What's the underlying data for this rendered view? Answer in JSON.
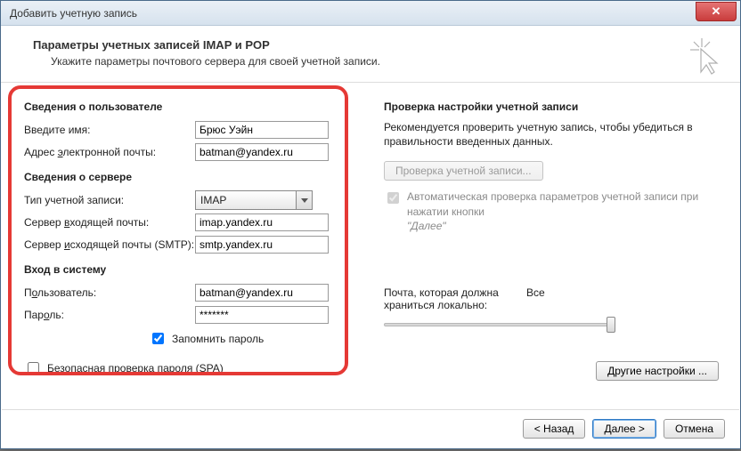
{
  "window": {
    "title": "Добавить учетную запись",
    "close_glyph": "✕"
  },
  "header": {
    "title": "Параметры учетных записей IMAP и POP",
    "sub": "Укажите параметры почтового сервера для своей учетной записи."
  },
  "sections": {
    "user": "Сведения о пользователе",
    "server": "Сведения о сервере",
    "login": "Вход в систему"
  },
  "labels": {
    "name": "Введите имя:",
    "email_pre": "Адрес ",
    "email_u": "э",
    "email_post": "лектронной почты:",
    "acct_type": "Тип учетной записи:",
    "in_server": "Сервер входящей почты:",
    "in_u": "в",
    "out_server": "Сервер ",
    "out_u": "и",
    "out_server_post": "сходящей почты (SMTP):",
    "user": "Пользователь:",
    "user_u": "о",
    "pass": "Пароль:",
    "pass_u": "о",
    "remember": "Запомнить пароль",
    "remember_u": "З",
    "spa": "езопасная проверка пароля (SPA)",
    "spa_u": "Б"
  },
  "values": {
    "name": "Брюс Уэйн",
    "email": "batman@yandex.ru",
    "acct_type": "IMAP",
    "in_server": "imap.yandex.ru",
    "out_server": "smtp.yandex.ru",
    "user": "batman@yandex.ru",
    "pass": "*******"
  },
  "right": {
    "title": "Проверка настройки учетной записи",
    "desc": "Рекомендуется проверить учетную запись, чтобы убедиться в правильности введенных данных.",
    "test_btn": "Проверка учетной записи...",
    "auto_test": "Автоматическая проверка параметров учетной записи при нажатии кнопки \"Далее\"",
    "slider_label": "Почта, которая должна храниться локально:",
    "slider_value": "Все",
    "other_btn": "Другие настройки ..."
  },
  "footer": {
    "back": "< Назад",
    "next": "Далее >",
    "cancel": "Отмена"
  }
}
